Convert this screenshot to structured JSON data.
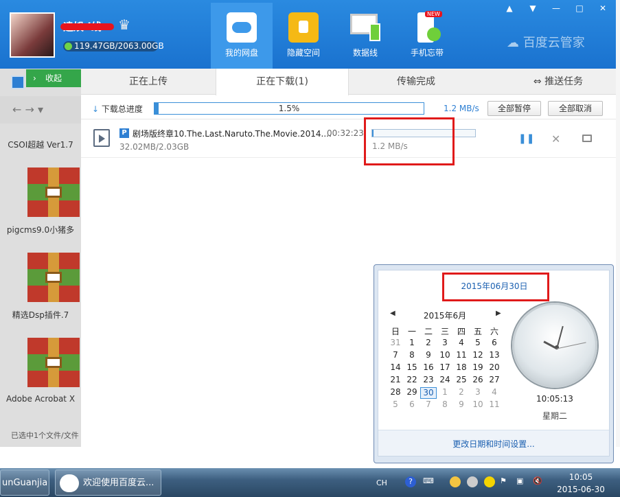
{
  "user": {
    "name": "遠娛d线",
    "quota": "119.47GB/2063.00GB"
  },
  "nav": [
    {
      "label": "我的网盘",
      "icon": "cloud-icon"
    },
    {
      "label": "隐藏空间",
      "icon": "lock-icon"
    },
    {
      "label": "数据线",
      "icon": "devices-icon"
    },
    {
      "label": "手机忘带",
      "icon": "phone-sync-icon",
      "badge": "NEW"
    }
  ],
  "brand": "百度云管家",
  "window_buttons": [
    "▲",
    "▼",
    "—",
    "□",
    "✕"
  ],
  "left": {
    "collapse": "收起",
    "files": [
      "CSOI超越 Ver1.7",
      "pigcms9.0小猪多",
      "精选Dsp插件.7",
      "Adobe Acrobat X"
    ],
    "selection": "已选中1个文件/文件"
  },
  "tabs": [
    "正在上传",
    "正在下载(1)",
    "传输完成",
    "推送任务"
  ],
  "download": {
    "total_label": "下载总进度",
    "total_percent": 1.5,
    "total_percent_text": "1.5%",
    "speed": "1.2 MB/s",
    "pause_all": "全部暂停",
    "cancel_all": "全部取消"
  },
  "task": {
    "name": "剧场版终章10.The.Last.Naruto.The.Movie.2014....",
    "time": "00:32:23",
    "size": "32.02MB/2.03GB",
    "speed": "1.2 MB/s",
    "progress": 1.5
  },
  "calendar": {
    "date_title": "2015年06月30日",
    "month": "2015年6月",
    "weekdays": [
      "日",
      "一",
      "二",
      "三",
      "四",
      "五",
      "六"
    ],
    "weeks": [
      [
        "31",
        "1",
        "2",
        "3",
        "4",
        "5",
        "6"
      ],
      [
        "7",
        "8",
        "9",
        "10",
        "11",
        "12",
        "13"
      ],
      [
        "14",
        "15",
        "16",
        "17",
        "18",
        "19",
        "20"
      ],
      [
        "21",
        "22",
        "23",
        "24",
        "25",
        "26",
        "27"
      ],
      [
        "28",
        "29",
        "30",
        "1",
        "2",
        "3",
        "4"
      ],
      [
        "5",
        "6",
        "7",
        "8",
        "9",
        "10",
        "11"
      ]
    ],
    "clock_time": "10:05:13",
    "weekday": "星期二",
    "settings_link": "更改日期和时间设置..."
  },
  "taskbar": {
    "item1": "unGuanjia",
    "item2": "欢迎使用百度云...",
    "lang": "CH",
    "time": "10:05",
    "date": "2015-06-30"
  }
}
